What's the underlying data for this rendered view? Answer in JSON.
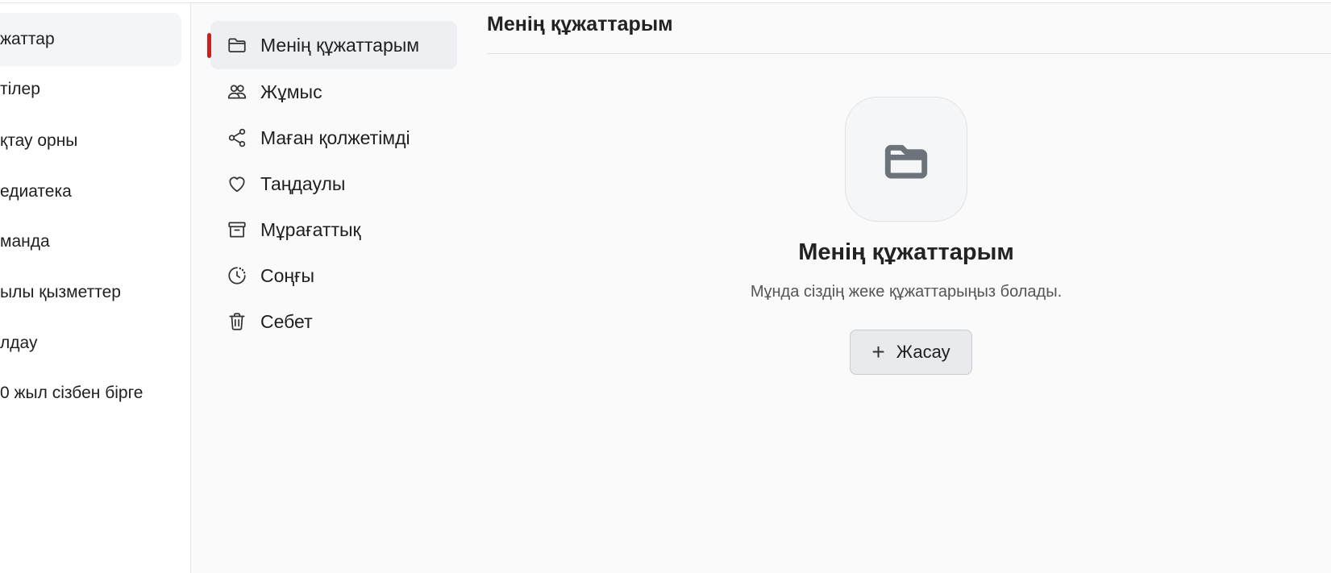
{
  "nav": {
    "items": [
      {
        "label": "жаттар",
        "active": true
      },
      {
        "label": "тілер",
        "active": false
      },
      {
        "label": "қтау орны",
        "active": false
      },
      {
        "label": "едиатека",
        "active": false
      },
      {
        "label": "манда",
        "active": false
      },
      {
        "label": "ылы қызметтер",
        "active": false
      },
      {
        "label": "лдау",
        "active": false
      },
      {
        "label": "0 жыл сізбен бірге",
        "active": false
      }
    ]
  },
  "subnav": {
    "items": [
      {
        "label": "Менің құжаттарым",
        "icon": "folder-icon",
        "active": true
      },
      {
        "label": "Жұмыс",
        "icon": "users-icon",
        "active": false
      },
      {
        "label": "Маған қолжетімді",
        "icon": "share-icon",
        "active": false
      },
      {
        "label": "Таңдаулы",
        "icon": "heart-icon",
        "active": false
      },
      {
        "label": "Мұрағаттық",
        "icon": "archive-icon",
        "active": false
      },
      {
        "label": "Соңғы",
        "icon": "clock-icon",
        "active": false
      },
      {
        "label": "Себет",
        "icon": "trash-icon",
        "active": false
      }
    ]
  },
  "main": {
    "title": "Менің құжаттарым",
    "empty": {
      "icon": "folder-icon",
      "title": "Менің құжаттарым",
      "subtitle": "Мұнда сіздің жеке құжаттарыңыз болады.",
      "button_label": "Жасау",
      "button_icon": "plus-icon"
    }
  },
  "colors": {
    "accent": "#cc1f1f",
    "active_bg": "#eeeff2",
    "background": "#fafafa"
  }
}
